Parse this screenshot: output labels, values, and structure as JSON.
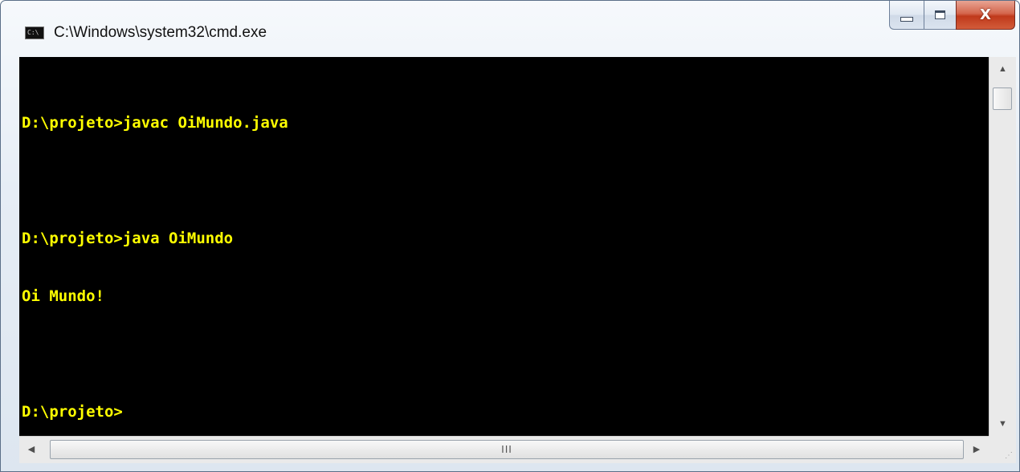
{
  "window": {
    "title": "C:\\Windows\\system32\\cmd.exe",
    "app_icon_text": "C:\\",
    "icon": "cmd-app-icon",
    "console_bg": "#000000",
    "console_fg": "#ffff00"
  },
  "caption_buttons": {
    "minimize_icon": "minimize-icon",
    "maximize_icon": "maximize-icon",
    "close_icon": "close-icon",
    "close_glyph": "X"
  },
  "console": {
    "lines": [
      "D:\\projeto>javac OiMundo.java",
      "",
      "D:\\projeto>java OiMundo",
      "Oi Mundo!",
      "",
      "D:\\projeto>"
    ]
  },
  "scrollbars": {
    "up_glyph": "▲",
    "down_glyph": "▼",
    "left_glyph": "◀",
    "right_glyph": "▶",
    "thumb_grip": "III",
    "size_grip": "⋰"
  }
}
